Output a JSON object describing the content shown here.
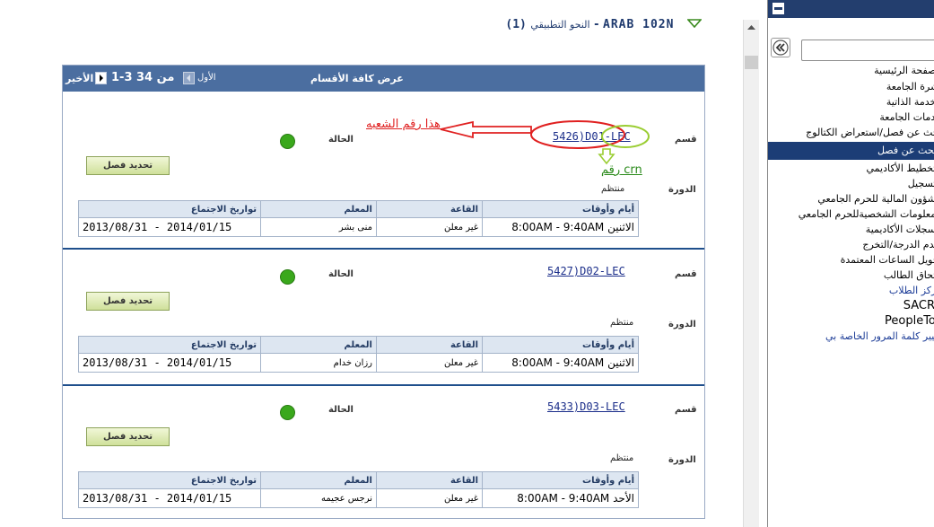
{
  "course_header": {
    "code": "ARAB  102N",
    "separator": "-",
    "title": "النحو التطبيقي",
    "count": "(1)"
  },
  "nav_bar": {
    "view_all": "عرض كافة الأقسام",
    "first": "الأول",
    "range": "1-3 من 34",
    "last": "الأخير"
  },
  "labels": {
    "section": "قسم",
    "status": "الحالة",
    "session": "الدورة",
    "select_button": "تحديد فصل"
  },
  "table_headers": [
    "أيام وأوقات",
    "القاعة",
    "المعلم",
    "تواريخ الاجتماع"
  ],
  "sections": [
    {
      "link": "5426)D01-LEC",
      "session_value": "منتظم",
      "status_color": "#3aa81c",
      "meeting": {
        "days_times": "الاثنين 8:00AM - 9:40AM",
        "room": "غير معلن",
        "instructor": "منى بشر",
        "dates": "2013/08/31 - 2014/01/15"
      }
    },
    {
      "link": "5427)D02-LEC",
      "session_value": "منتظم",
      "status_color": "#3aa81c",
      "meeting": {
        "days_times": "الاثنين 8:00AM - 9:40AM",
        "room": "غير معلن",
        "instructor": "رزان خدام",
        "dates": "2013/08/31 - 2014/01/15"
      }
    },
    {
      "link": "5433)D03-LEC",
      "session_value": "منتظم",
      "status_color": "#3aa81c",
      "meeting": {
        "days_times": "الأحد 8:00AM - 9:40AM",
        "room": "غير معلن",
        "instructor": "نرجس عجيمه",
        "dates": "2013/08/31 - 2014/01/15"
      }
    }
  ],
  "annotations": {
    "section_number_note": "هذا رقم الشعبه",
    "crn_note": "رقم crn",
    "red": "#e02020",
    "green": "#9acd32"
  },
  "side_menu": {
    "items": [
      "الصفحة الرئيسية",
      "نشرة الجامعة",
      "الخدمة الذاتية",
      "خدمات الجامعة",
      "بحث عن فصل/استعراض الكتالوج",
      "بحث عن فصل",
      "التخطيط الأكاديمي",
      "التسجيل",
      "الشؤون المالية للحرم الجامعي",
      "المعلومات الشخصيةللحرم الجامعي",
      "السجلات الأكاديمية",
      "تقدم الدرجة/التخرج",
      "تحويل الساعات المعتمدة",
      "التحاق الطالب",
      "مركز الطلاب",
      "SACR",
      "PeopleTools",
      "تغيير كلمة المرور الخاصة بي"
    ]
  }
}
